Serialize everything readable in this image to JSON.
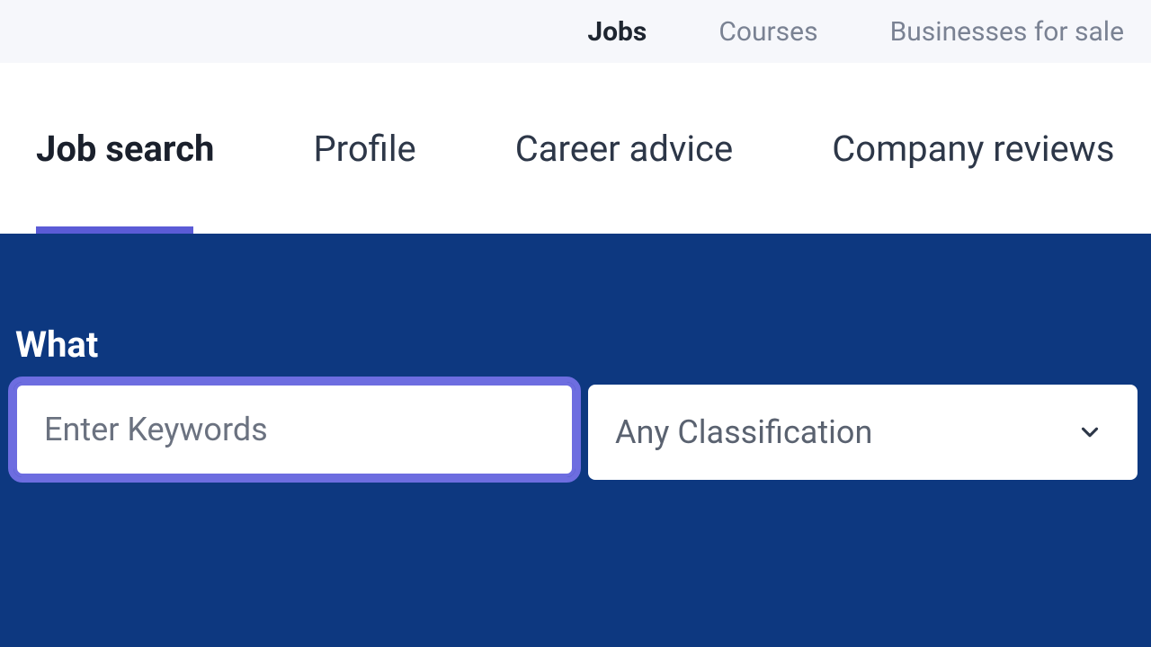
{
  "top_nav": {
    "items": [
      {
        "label": "Jobs",
        "active": true
      },
      {
        "label": "Courses",
        "active": false
      },
      {
        "label": "Businesses for sale",
        "active": false
      }
    ]
  },
  "main_nav": {
    "items": [
      {
        "label": "Job search",
        "active": true
      },
      {
        "label": "Profile",
        "active": false
      },
      {
        "label": "Career advice",
        "active": false
      },
      {
        "label": "Company reviews",
        "active": false
      }
    ]
  },
  "search": {
    "label": "What",
    "keywords_placeholder": "Enter Keywords",
    "keywords_value": "",
    "classification_selected": "Any Classification"
  },
  "colors": {
    "brand_blue": "#0d3880",
    "accent_purple": "#5b5bd6",
    "focus_ring": "#6d6de0"
  }
}
